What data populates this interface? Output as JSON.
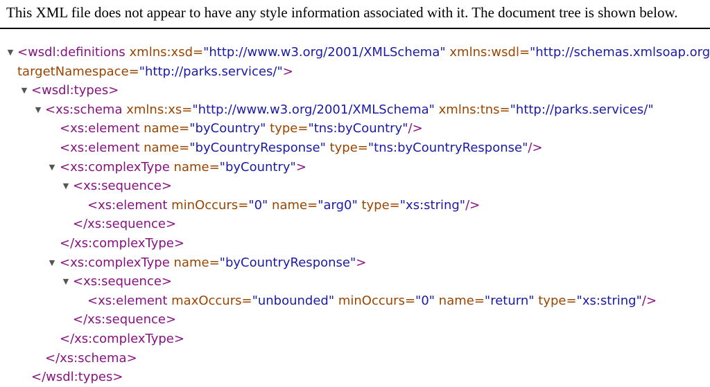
{
  "header": {
    "text": "This XML file does not appear to have any style information associated with it. The document tree is shown below."
  },
  "colors": {
    "tag": "#881280",
    "attr": "#994500",
    "value": "#1a1aa6",
    "collapse": "#555555"
  },
  "icons": {
    "expanded": "triangle-down-icon"
  },
  "tree": {
    "l1": {
      "open": "<wsdl:definitions",
      "a1": " xmlns:xsd=",
      "v1": "\"http://www.w3.org/2001/XMLSchema\"",
      "a2": " xmlns:wsdl=",
      "v2": "\"http://schemas.xmlsoap.org/wsdl/\""
    },
    "l2": {
      "a1": "targetNamespace=",
      "v1": "\"http://parks.services/\"",
      "close": ">"
    },
    "l3": {
      "text": "<wsdl:types>"
    },
    "l4": {
      "open": "<xs:schema",
      "a1": " xmlns:xs=",
      "v1": "\"http://www.w3.org/2001/XMLSchema\"",
      "a2": " xmlns:tns=",
      "v2": "\"http://parks.services/\""
    },
    "l5": {
      "open": "<xs:element",
      "a1": " name=",
      "v1": "\"byCountry\"",
      "a2": " type=",
      "v2": "\"tns:byCountry\"",
      "close": "/>"
    },
    "l6": {
      "open": "<xs:element",
      "a1": " name=",
      "v1": "\"byCountryResponse\"",
      "a2": " type=",
      "v2": "\"tns:byCountryResponse\"",
      "close": "/>"
    },
    "l7": {
      "open": "<xs:complexType",
      "a1": " name=",
      "v1": "\"byCountry\"",
      "close": ">"
    },
    "l8": {
      "text": "<xs:sequence>"
    },
    "l9": {
      "open": "<xs:element",
      "a1": " minOccurs=",
      "v1": "\"0\"",
      "a2": " name=",
      "v2": "\"arg0\"",
      "a3": " type=",
      "v3": "\"xs:string\"",
      "close": "/>"
    },
    "l10": {
      "text": "</xs:sequence>"
    },
    "l11": {
      "text": "</xs:complexType>"
    },
    "l12": {
      "open": "<xs:complexType",
      "a1": " name=",
      "v1": "\"byCountryResponse\"",
      "close": ">"
    },
    "l13": {
      "text": "<xs:sequence>"
    },
    "l14": {
      "open": "<xs:element",
      "a1": " maxOccurs=",
      "v1": "\"unbounded\"",
      "a2": " minOccurs=",
      "v2": "\"0\"",
      "a3": " name=",
      "v3": "\"return\"",
      "a4": " type=",
      "v4": "\"xs:string\"",
      "close": "/>"
    },
    "l15": {
      "text": "</xs:sequence>"
    },
    "l16": {
      "text": "</xs:complexType>"
    },
    "l17": {
      "text": "</xs:schema>"
    },
    "l18": {
      "text": "</wsdl:types>"
    }
  }
}
